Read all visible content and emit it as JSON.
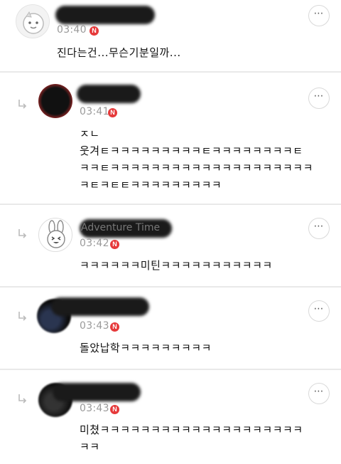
{
  "comments": [
    {
      "name": "",
      "time": "03:40",
      "badge": "N",
      "more": "⋯",
      "body": "진다는건...무슨기분일까..."
    },
    {
      "name": "",
      "time": "03:41",
      "badge": "N",
      "more": "⋯",
      "body": "ㅈㄴ\n웃겨ㅌㅋㅋㅋㅋㅋㅋㅋㅋㅋㅌㅋㅋㅋㅋㅋㅋㅋㅋㅌ\nㅋㅋㅌㅋㅋㅋㅋㅋㅋㅋㅋㅋㅋㅋㅋㅋㅋㅋㅋㅋㅋㅋㅋ\nㅋㅌㅋㅌㅌㅋㅋㅋㅋㅋㅋㅋㅋㅋ"
    },
    {
      "name": "Adventure Time",
      "time": "03:42",
      "badge": "N",
      "more": "⋯",
      "body": "ㅋㅋㅋㅋㅋㅋ미틴ㅋㅋㅋㅋㅋㅋㅋㅋㅋㅋㅋ"
    },
    {
      "name": "",
      "time": "03:43",
      "badge": "N",
      "more": "⋯",
      "body": "돌았납학ㅋㅋㅋㅋㅋㅋㅋㅋㅋ"
    },
    {
      "name": "",
      "time": "03:43",
      "badge": "N",
      "more": "⋯",
      "body": "미쳤ㅋㅋㅋㅋㅋㅋㅋㅋㅋㅋㅋㅋㅋㅋㅋㅋㅋㅋㅋㅋ\nㅋㅋ"
    }
  ]
}
